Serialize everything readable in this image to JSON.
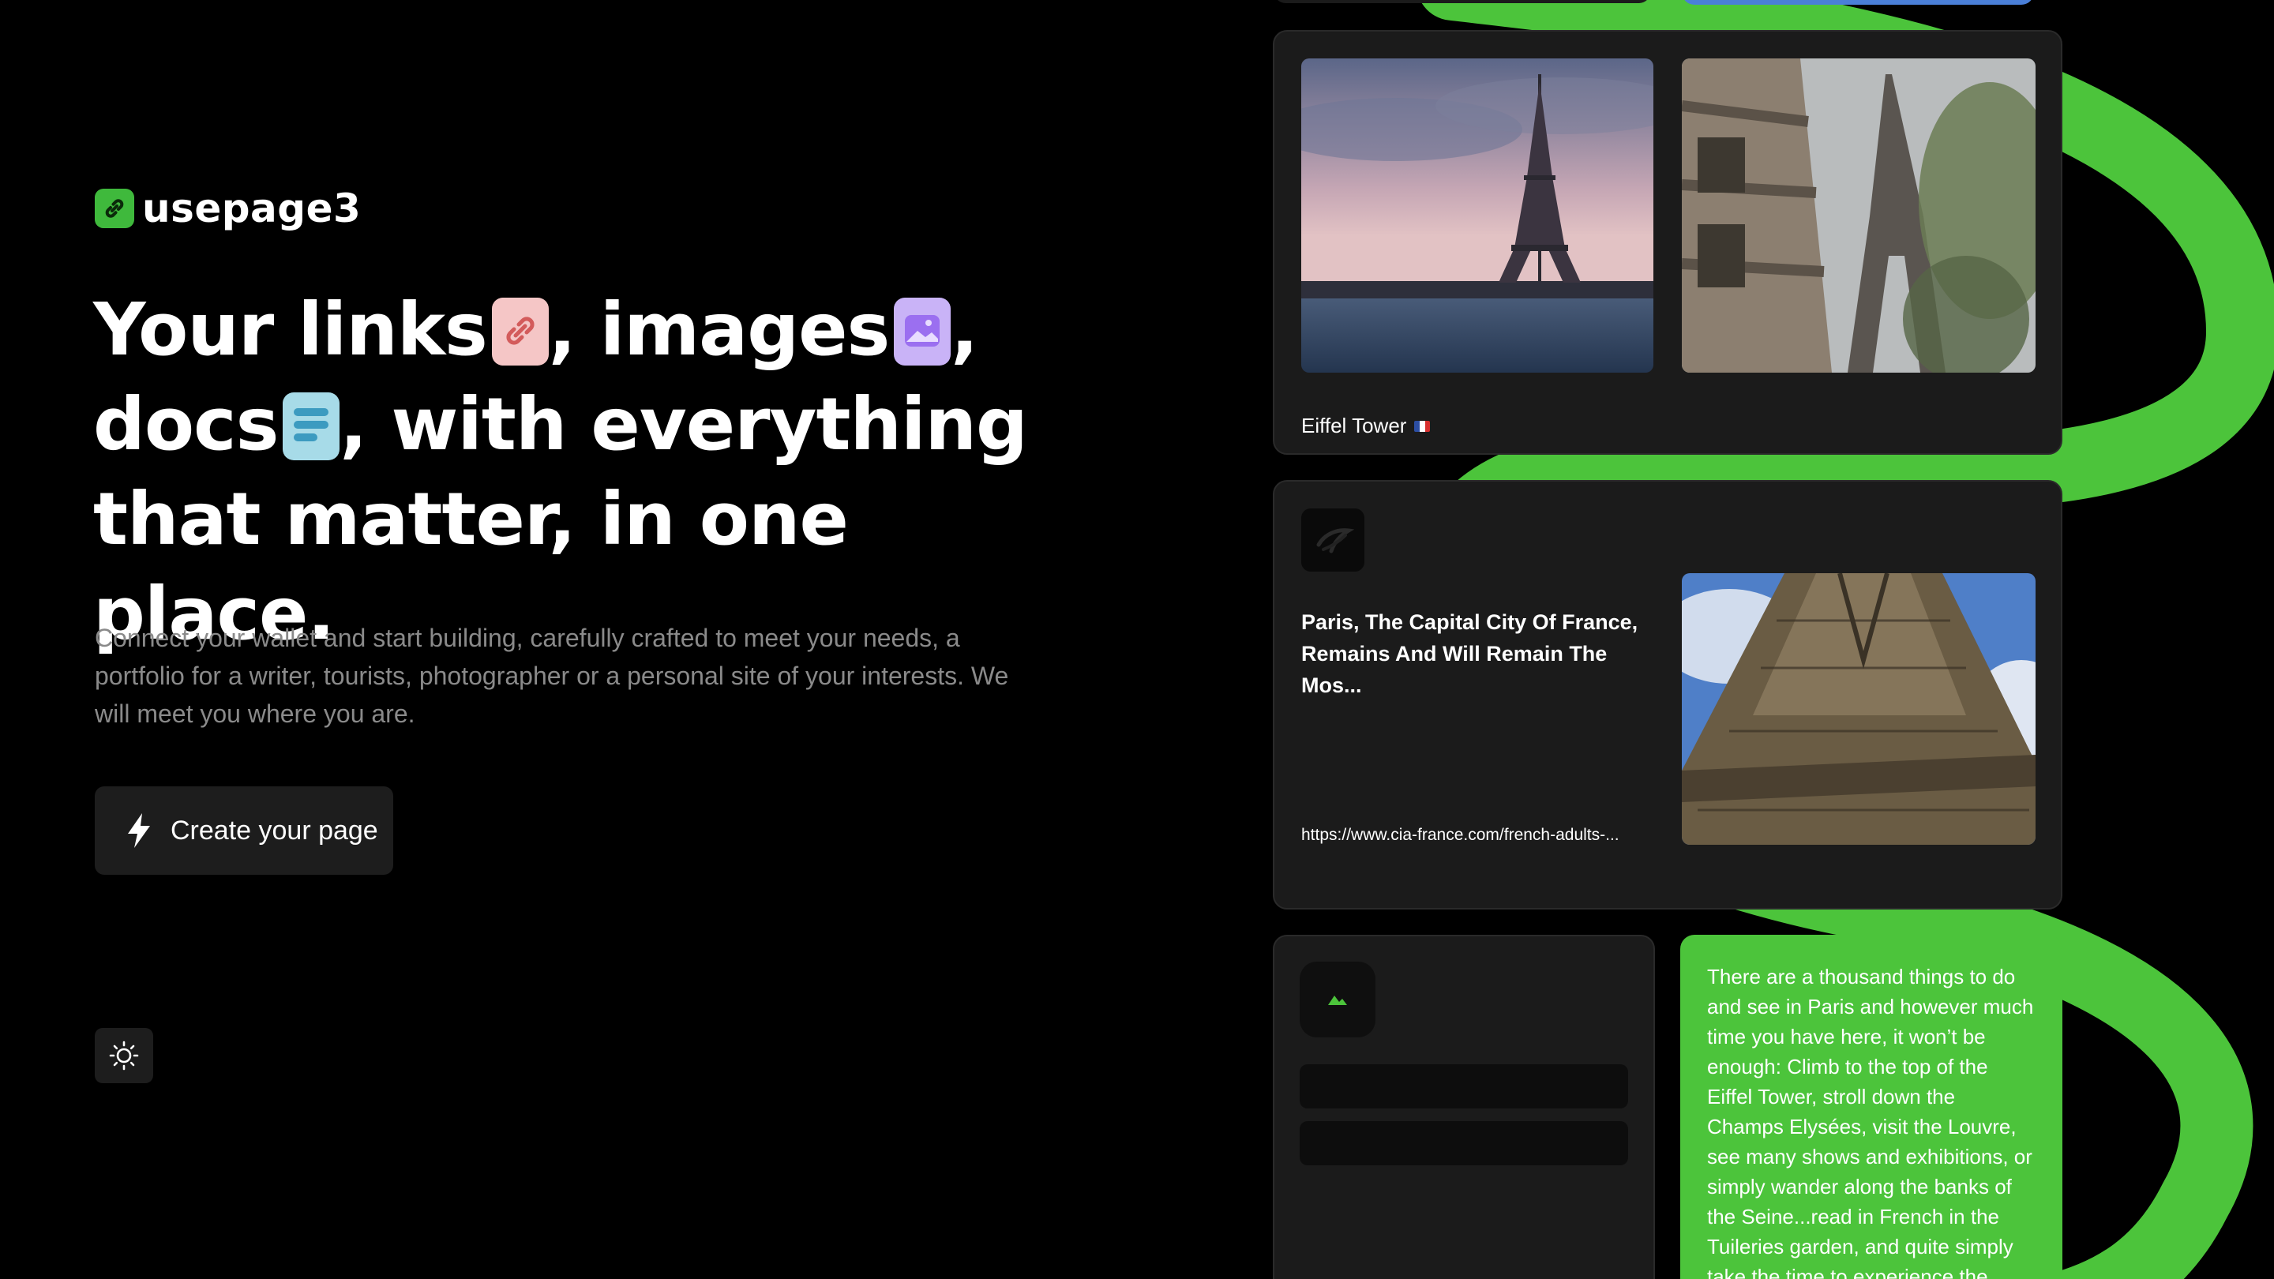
{
  "brand": {
    "name": "usepage3",
    "logo_icon": "link-icon",
    "accent": "#3fb93c"
  },
  "hero": {
    "line1_part1": "Your links",
    "line1_part2": ", images",
    "line1_part3": ",",
    "line2_part1": "docs",
    "line2_part2": ", with everything",
    "line3": "that matter, in one place.",
    "emoji_icons": [
      "link-emoji-icon",
      "image-emoji-icon",
      "doc-emoji-icon"
    ]
  },
  "description": "Connect your wallet and start building, carefully crafted to meet your needs, a portfolio for a writer, tourists, photographer or a personal site of your interests. We will meet you where you are.",
  "cta": {
    "label": "Create your page",
    "icon": "lightning-icon"
  },
  "theme_toggle": {
    "icon": "sun-icon"
  },
  "cards": {
    "tower": {
      "caption": "Eiffel Tower",
      "flag": "france-flag-icon"
    },
    "article": {
      "title": "Paris, The Capital City Of France, Remains And Will Remain The Mos...",
      "url": "https://www.cia-france.com/french-adults-..."
    },
    "map": {
      "icon": "map-icon"
    },
    "note": {
      "text": "There are a thousand things to do and see in Paris and however much time you have here, it won’t be enough: Climb to the top of the Eiffel Tower, stroll down the Champs Elysées, visit the Louvre, see many shows and exhibitions, or simply wander along the banks of the Seine...read in French in the Tuileries garden, and quite simply take the time to experience the"
    }
  },
  "colors": {
    "background": "#000000",
    "card": "#1b1b1b",
    "note": "#4cc43b",
    "muted_text": "#8a8a8a"
  }
}
